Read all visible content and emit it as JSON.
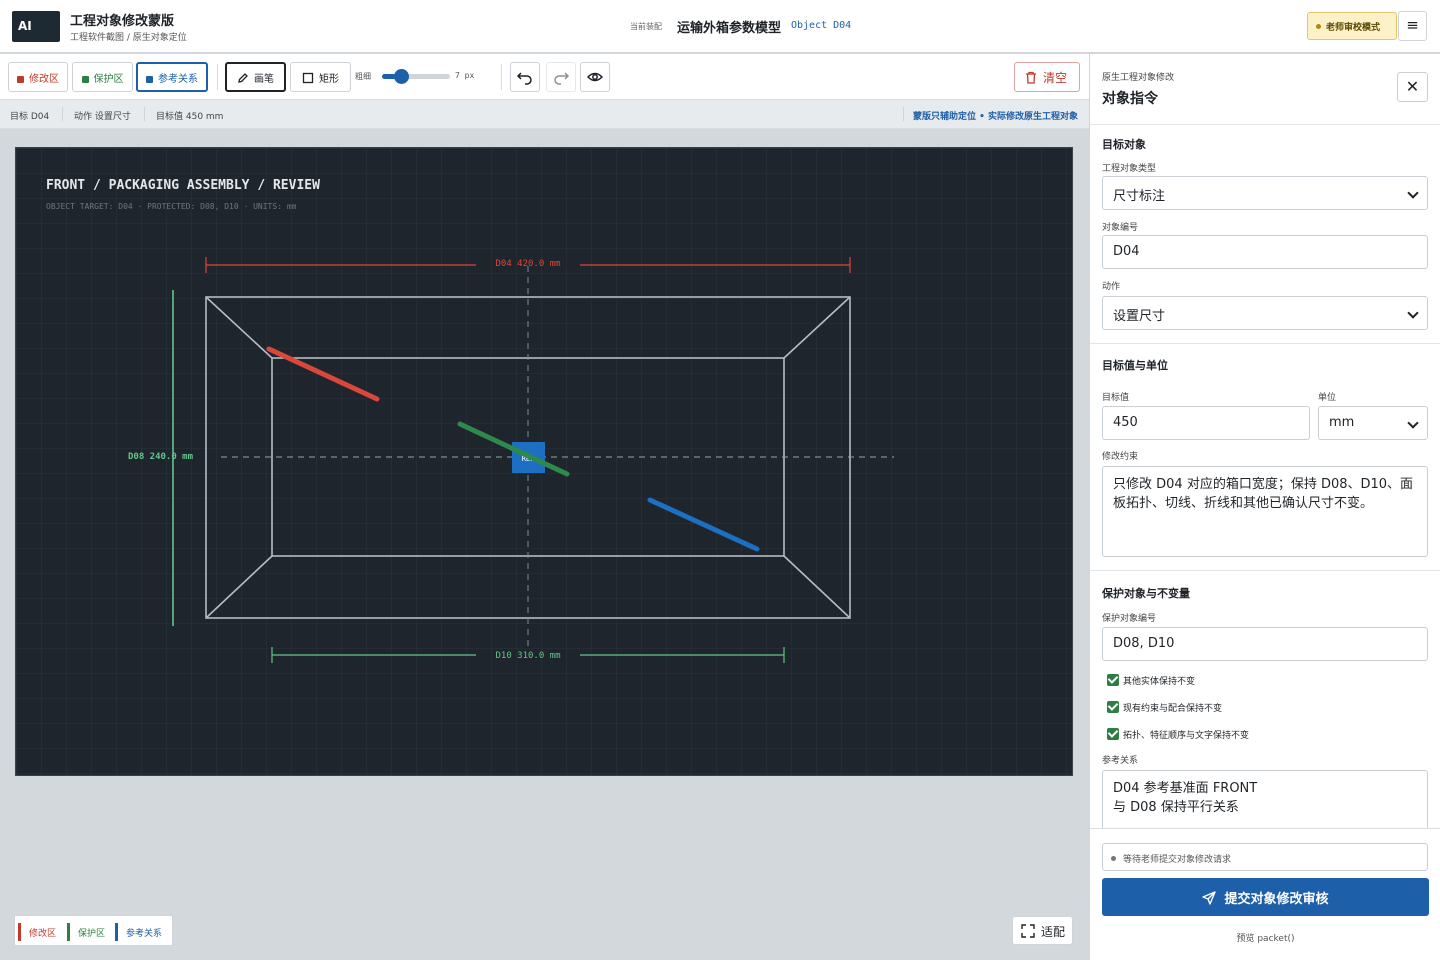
{
  "header": {
    "logo": "AI",
    "title": "工程对象修改蒙版",
    "subtitle": "工程软件截图 / 原生对象定位",
    "current_label": "当前装配",
    "model_name": "运输外箱参数模型",
    "object_id": "Object D04",
    "review_mode": "老师审校模式",
    "menu_icon": "≡"
  },
  "toolbar": {
    "modify": "修改区",
    "protect": "保护区",
    "reference": "参考关系",
    "pen": "画笔",
    "rect": "矩形",
    "brush_label": "粗细",
    "brush_value": "7 px",
    "brush_fraction": 0.29,
    "clear": "清空"
  },
  "status": {
    "target": "目标 D04",
    "action": "动作 设置尺寸",
    "value": "目标值 450 mm",
    "note": "蒙版只辅助定位 • 实际修改原生工程对象"
  },
  "drawing": {
    "title": "FRONT / PACKAGING ASSEMBLY / REVIEW",
    "meta": "OBJECT TARGET: D04  ·  PROTECTED: D08, D10  ·  UNITS: mm",
    "dim_top": "D04  420.0 mm",
    "dim_left": "D08  240.0 mm",
    "dim_bottom": "D10  310.0 mm",
    "center_tag": "REF"
  },
  "legend": {
    "modify": "修改区",
    "protect": "保护区",
    "reference": "参考关系"
  },
  "fit": "适配",
  "panel": {
    "kicker": "原生工程对象修改",
    "title": "对象指令",
    "close_icon": "✕",
    "target": {
      "heading": "目标对象",
      "type_label": "工程对象类型",
      "type_value": "尺寸标注",
      "id_label": "对象编号",
      "id_value": "D04",
      "action_label": "动作",
      "action_value": "设置尺寸"
    },
    "value": {
      "heading": "目标值与单位",
      "value_label": "目标值",
      "value": "450",
      "unit_label": "单位",
      "unit": "mm",
      "constraint_label": "修改约束",
      "constraint": "只修改 D04 对应的箱口宽度；保持 D08、D10、面板拓扑、切线、折线和其他已确认尺寸不变。"
    },
    "protect": {
      "heading": "保护对象与不变量",
      "ids_label": "保护对象编号",
      "ids": "D08, D10",
      "check1": "其他实体保持不变",
      "check2": "现有约束与配合保持不变",
      "check3": "拓扑、特征顺序与文字保持不变",
      "ref_label": "参考关系",
      "ref_line1": "D04 参考基准面 FRONT",
      "ref_line2": "与 D08 保持平行关系"
    },
    "footer": {
      "wait": "等待老师提交对象修改请求",
      "submit": "提交对象修改审核",
      "preview": "预览 packet()"
    }
  },
  "colors": {
    "modify": "#c0392b",
    "protect": "#2e7d43",
    "reference": "#1d5fa8"
  }
}
